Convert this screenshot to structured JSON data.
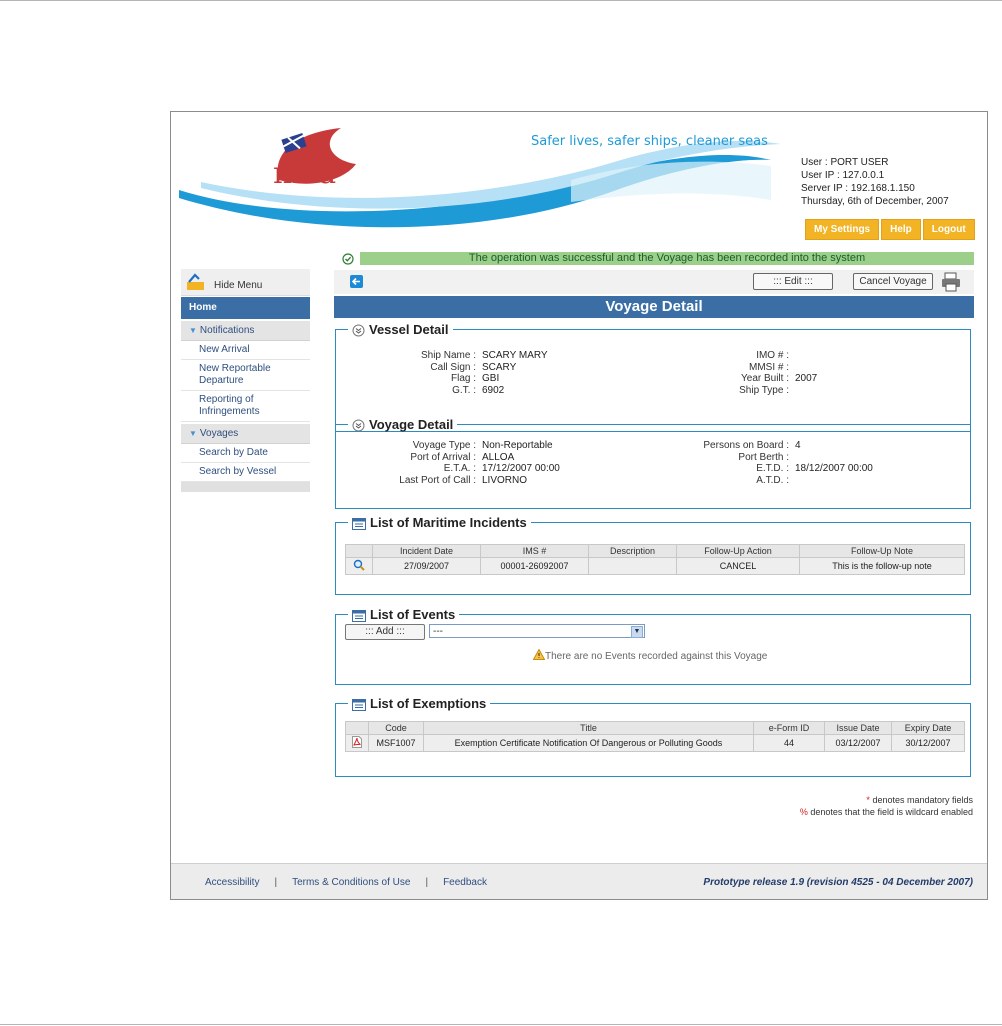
{
  "header": {
    "tagline": "Safer lives,  safer ships, cleaner seas",
    "logo_text": "mca",
    "user_lines": [
      "User : PORT USER",
      "User IP : 127.0.0.1",
      "Server IP : 192.168.1.150",
      "Thursday, 6th of December, 2007"
    ],
    "buttons": [
      "My Settings",
      "Help",
      "Logout"
    ]
  },
  "sidebar": {
    "hide_menu": "Hide Menu",
    "home": "Home",
    "sections": [
      {
        "label": "Notifications",
        "items": [
          "New Arrival",
          "New Reportable Departure",
          "Reporting of Infringements"
        ]
      },
      {
        "label": "Voyages",
        "items": [
          "Search by Date",
          "Search by Vessel"
        ]
      }
    ]
  },
  "message": "The operation was successful and the Voyage has been recorded into the system",
  "toolbar": {
    "edit": "::: Edit :::",
    "cancel": "Cancel Voyage"
  },
  "page_title": "Voyage Detail",
  "vessel": {
    "legend": "Vessel Detail",
    "left": [
      [
        "Ship Name :",
        "SCARY MARY"
      ],
      [
        "Call Sign :",
        "SCARY"
      ],
      [
        "Flag :",
        "GBI"
      ],
      [
        "G.T. :",
        "6902"
      ]
    ],
    "right": [
      [
        "IMO # :",
        ""
      ],
      [
        "MMSI # :",
        ""
      ],
      [
        "Year Built :",
        "2007"
      ],
      [
        "Ship Type :",
        ""
      ]
    ]
  },
  "voyage": {
    "legend": "Voyage Detail",
    "left": [
      [
        "Voyage Type :",
        "Non-Reportable"
      ],
      [
        "Port of Arrival :",
        "ALLOA"
      ],
      [
        "E.T.A. :",
        "17/12/2007 00:00"
      ],
      [
        "Last Port of Call :",
        "LIVORNO"
      ]
    ],
    "right": [
      [
        "Persons on Board :",
        "4"
      ],
      [
        "Port Berth :",
        ""
      ],
      [
        "E.T.D. :",
        "18/12/2007 00:00"
      ],
      [
        "A.T.D. :",
        ""
      ]
    ]
  },
  "incidents": {
    "legend": "List of Maritime Incidents",
    "columns": [
      "Incident Date",
      "IMS #",
      "Description",
      "Follow-Up Action",
      "Follow-Up Note"
    ],
    "rows": [
      [
        "27/09/2007",
        "00001-26092007",
        "",
        "CANCEL",
        "This is the follow-up note"
      ]
    ]
  },
  "events": {
    "legend": "List of Events",
    "add": "::: Add :::",
    "select_value": "---",
    "empty": "There are no Events recorded against this Voyage"
  },
  "exemptions": {
    "legend": "List of Exemptions",
    "columns": [
      "Code",
      "Title",
      "e-Form ID",
      "Issue Date",
      "Expiry Date"
    ],
    "rows": [
      [
        "MSF1007",
        "Exemption Certificate Notification Of Dangerous or Polluting Goods",
        "44",
        "03/12/2007",
        "30/12/2007"
      ]
    ]
  },
  "notes": {
    "mandatory": "denotes mandatory fields",
    "wildcard": "denotes that the field is wildcard enabled"
  },
  "footer": {
    "links": [
      "Accessibility",
      "Terms & Conditions of Use",
      "Feedback"
    ],
    "release": "Prototype release 1.9 (revision 4525 - 04 December 2007)"
  },
  "colors": {
    "brand_blue": "#3a6ea5",
    "accent_orange": "#f2b324",
    "success_green": "#9bcf8a",
    "wave_blue": "#1e9ad6"
  }
}
